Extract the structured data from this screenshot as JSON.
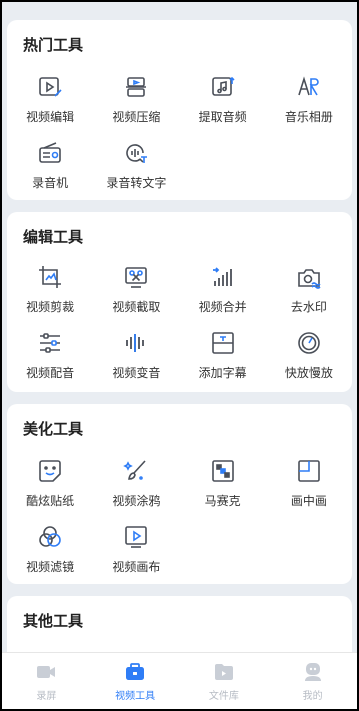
{
  "colors": {
    "accent": "#2f7df6",
    "icon": "#4a4f58",
    "tab_inactive": "#c9ced6"
  },
  "sections": [
    {
      "title": "热门工具",
      "items": [
        {
          "label": "视频编辑",
          "icon": "video-edit-icon"
        },
        {
          "label": "视频压缩",
          "icon": "video-compress-icon"
        },
        {
          "label": "提取音频",
          "icon": "extract-audio-icon"
        },
        {
          "label": "音乐相册",
          "icon": "music-album-icon"
        },
        {
          "label": "录音机",
          "icon": "radio-recorder-icon"
        },
        {
          "label": "录音转文字",
          "icon": "speech-to-text-icon"
        }
      ]
    },
    {
      "title": "编辑工具",
      "items": [
        {
          "label": "视频剪裁",
          "icon": "crop-icon"
        },
        {
          "label": "视频截取",
          "icon": "video-cut-icon"
        },
        {
          "label": "视频合并",
          "icon": "merge-icon"
        },
        {
          "label": "去水印",
          "icon": "remove-watermark-icon"
        },
        {
          "label": "视频配音",
          "icon": "dubbing-icon"
        },
        {
          "label": "视频变音",
          "icon": "voice-change-icon"
        },
        {
          "label": "添加字幕",
          "icon": "subtitle-icon"
        },
        {
          "label": "快放慢放",
          "icon": "speed-icon"
        }
      ]
    },
    {
      "title": "美化工具",
      "items": [
        {
          "label": "酷炫贴纸",
          "icon": "sticker-icon"
        },
        {
          "label": "视频涂鸦",
          "icon": "doodle-icon"
        },
        {
          "label": "马赛克",
          "icon": "mosaic-icon"
        },
        {
          "label": "画中画",
          "icon": "picture-in-picture-icon"
        },
        {
          "label": "视频滤镜",
          "icon": "filter-icon"
        },
        {
          "label": "视频画布",
          "icon": "canvas-icon"
        }
      ]
    },
    {
      "title": "其他工具",
      "items": []
    }
  ],
  "tabbar": [
    {
      "label": "录屏",
      "icon": "record-screen-icon",
      "active": false
    },
    {
      "label": "视频工具",
      "icon": "toolbox-icon",
      "active": true
    },
    {
      "label": "文件库",
      "icon": "file-library-icon",
      "active": false
    },
    {
      "label": "我的",
      "icon": "profile-icon",
      "active": false
    }
  ]
}
